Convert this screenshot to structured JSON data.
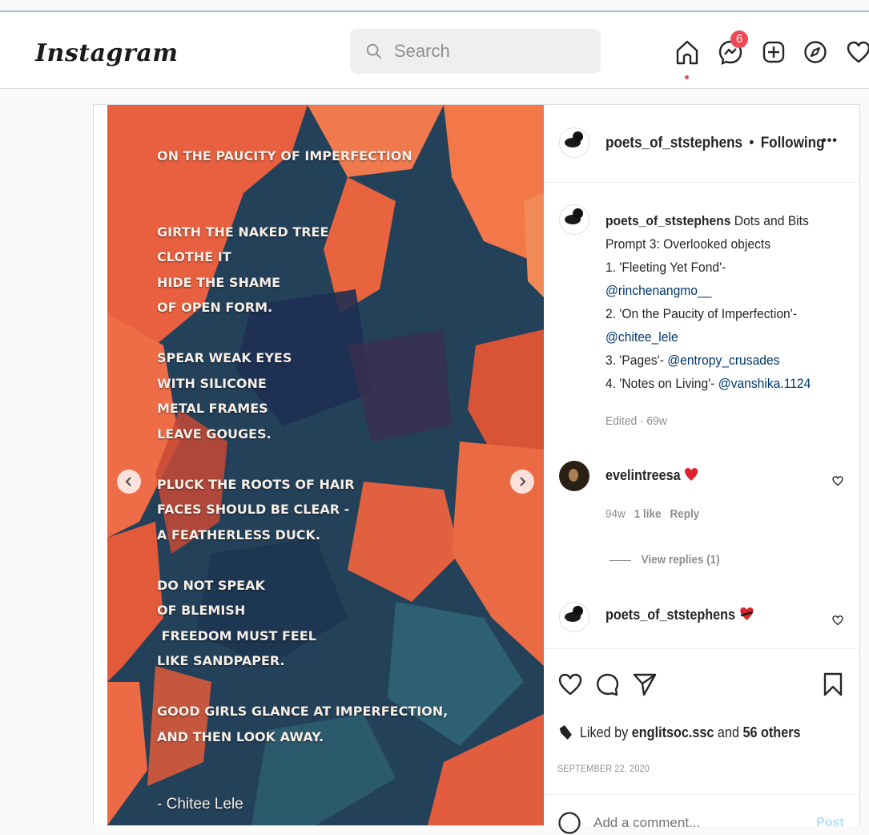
{
  "header": {
    "logo": "Instagram",
    "search_placeholder": "Search",
    "notifications_badge": "6"
  },
  "post": {
    "poem_lines": [
      "ON THE PAUCITY OF IMPERFECTION",
      "",
      "",
      "GIRTH THE NAKED TREE",
      "CLOTHE IT",
      "HIDE THE SHAME",
      "OF OPEN FORM.",
      "",
      "SPEAR WEAK EYES",
      "WITH SILICONE",
      "METAL FRAMES",
      "LEAVE GOUGES.",
      "",
      "PLUCK THE ROOTS OF HAIR",
      "FACES SHOULD BE CLEAR -",
      "A FEATHERLESS DUCK.",
      "",
      "DO NOT SPEAK",
      "OF BLEMISH",
      " FREEDOM MUST FEEL",
      "LIKE SANDPAPER.",
      "",
      "GOOD GIRLS GLANCE AT IMPERFECTION,",
      "AND THEN LOOK AWAY."
    ],
    "author": "- Chitee Lele",
    "owner": {
      "username": "poets_of_ststephens",
      "separator": "•",
      "follow_status": "Following",
      "more": "•••"
    },
    "caption": {
      "username": "poets_of_ststephens",
      "line1_rest": "Dots and Bits",
      "line2": "Prompt 3: Overlooked objects",
      "line3": "1. 'Fleeting Yet Fond'-",
      "line4_mention": "@rinchenangmo__",
      "line5": "2. 'On the Paucity of Imperfection'-",
      "line6_mention": "@chitee_lele",
      "line7_text": "3. 'Pages'-",
      "line7_mention": "@entropy_crusades",
      "line8_text": "4. 'Notes on Living'-",
      "line8_mention": "@vanshika.1124",
      "edited": "Edited · 69w"
    },
    "comments": [
      {
        "username": "evelintreesa",
        "time": "94w",
        "likes": "1 like",
        "reply": "Reply",
        "view_replies": "View replies (1)"
      },
      {
        "username": "poets_of_ststephens"
      }
    ],
    "liked_by": {
      "prefix": "Liked by",
      "user": "englitsoc.ssc",
      "and": "and",
      "others": "56 others"
    },
    "date": "SEPTEMBER 22, 2020",
    "add_comment_placeholder": "Add a comment...",
    "post_button": "Post"
  },
  "colors": {
    "accent_red": "#ed4956",
    "link_blue": "#00376b",
    "muted": "#8e8e8e"
  }
}
